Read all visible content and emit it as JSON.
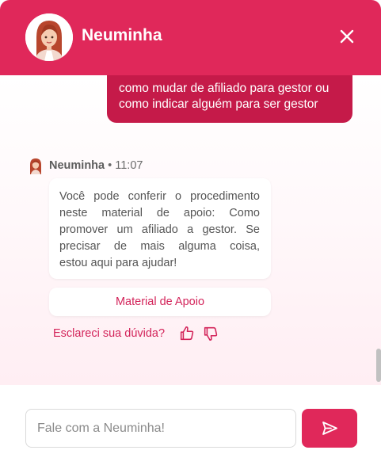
{
  "header": {
    "title": "Neuminha",
    "close_icon": "close-icon",
    "accent_color": "#e0285a"
  },
  "user_message": {
    "line1": "como mudar de afiliado para gestor ou",
    "line2": "como indicar alguém para ser gestor"
  },
  "bot_message": {
    "sender": "Neuminha",
    "separator": "•",
    "time": "11:07",
    "lines": [
      "Você pode conferir o procedimento",
      "neste material de apoio: Como",
      "promover um afiliado a gestor. Se",
      "precisar de mais alguma coisa,",
      "estou aqui para ajudar!"
    ],
    "link_label": "Material de Apoio"
  },
  "feedback": {
    "question": "Esclareci sua dúvida?",
    "up_icon": "thumbs-up-icon",
    "down_icon": "thumbs-down-icon"
  },
  "composer": {
    "placeholder": "Fale com a Neuminha!",
    "value": "",
    "send_icon": "send-icon"
  }
}
